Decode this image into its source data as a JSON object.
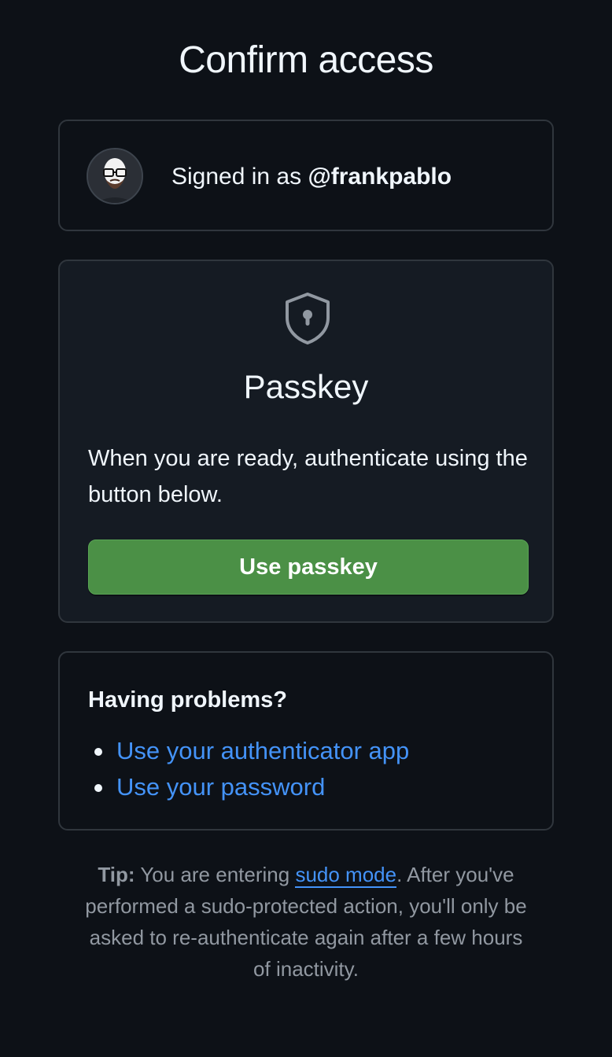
{
  "page": {
    "title": "Confirm access"
  },
  "account": {
    "signed_in_prefix": "Signed in as",
    "username": "@frankpablo",
    "avatar_icon": "user-avatar"
  },
  "passkey": {
    "icon": "shield-lock-icon",
    "title": "Passkey",
    "description": "When you are ready, authenticate using the button below.",
    "button_label": "Use passkey"
  },
  "problems": {
    "title": "Having problems?",
    "links": [
      {
        "label": "Use your authenticator app"
      },
      {
        "label": "Use your password"
      }
    ]
  },
  "tip": {
    "label": "Tip:",
    "text_before_link": "You are entering",
    "link_label": "sudo mode",
    "text_after_link": ". After you've performed a sudo-protected action, you'll only be asked to re-authenticate again after a few hours of inactivity."
  },
  "colors": {
    "background": "#0d1117",
    "card_border": "#30363d",
    "passkey_card_bg": "#151b23",
    "primary_button": "#4b9046",
    "link": "#4493f8",
    "muted_text": "#9198a1"
  }
}
